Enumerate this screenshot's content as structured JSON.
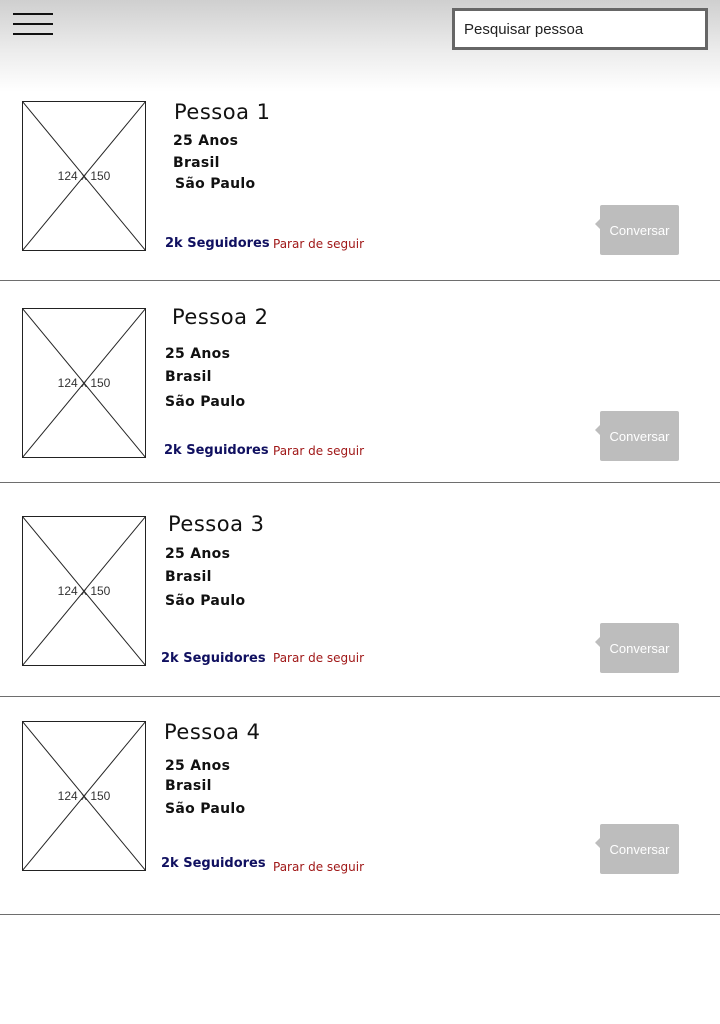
{
  "header": {
    "menu_icon": "hamburger-menu-icon",
    "search": {
      "placeholder": "Pesquisar pessoa",
      "value": ""
    }
  },
  "people": [
    {
      "name": "Pessoa 1",
      "age": "25 Anos",
      "country": "Brasil",
      "city": "São Paulo",
      "followers": "2k Seguidores",
      "unfollow": "Parar de seguir",
      "chat": "Conversar",
      "image_label": "124 x 150"
    },
    {
      "name": "Pessoa 2",
      "age": "25 Anos",
      "country": "Brasil",
      "city": "São Paulo",
      "followers": "2k Seguidores",
      "unfollow": "Parar de seguir",
      "chat": "Conversar",
      "image_label": "124 x 150"
    },
    {
      "name": "Pessoa 3",
      "age": "25 Anos",
      "country": "Brasil",
      "city": "São Paulo",
      "followers": "2k Seguidores",
      "unfollow": "Parar de seguir",
      "chat": "Conversar",
      "image_label": "124 x 150"
    },
    {
      "name": "Pessoa 4",
      "age": "25 Anos",
      "country": "Brasil",
      "city": "São Paulo",
      "followers": "2k Seguidores",
      "unfollow": "Parar de seguir",
      "chat": "Conversar",
      "image_label": "124 x 150"
    }
  ],
  "colors": {
    "followers": "#101060",
    "unfollow": "#a01818",
    "chat_button": "#bdbdbd"
  }
}
